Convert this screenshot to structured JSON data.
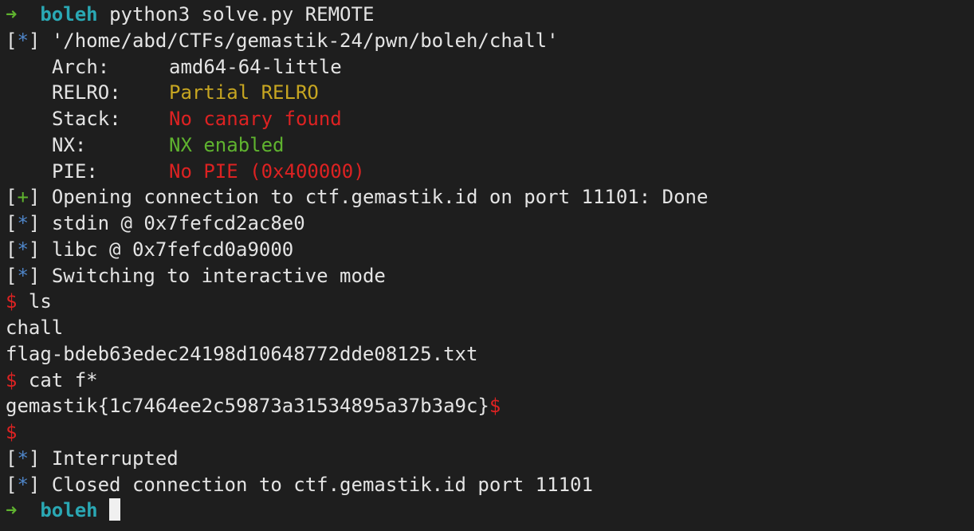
{
  "colors": {
    "background": "#1e1e1e",
    "text": "#e4e4e4",
    "prompt_arrow": "#5fb32f",
    "prompt_dir": "#2aa8b4",
    "info_marker": "#4f86c9",
    "success_marker": "#5fb32f",
    "shell_prompt": "#dd2222",
    "warning": "#c7a621",
    "ok": "#5fb32f"
  },
  "prompt": {
    "arrow": "➜",
    "dir": "boleh",
    "command": "python3 solve.py REMOTE"
  },
  "marker": {
    "open": "[",
    "close": "]",
    "info": "*",
    "success": "+"
  },
  "binary_path": "'/home/abd/CTFs/gemastik-24/pwn/boleh/chall'",
  "checksec": {
    "arch_key": "Arch:",
    "arch_value": "amd64-64-little",
    "relro_key": "RELRO:",
    "relro_value": "Partial RELRO",
    "stack_key": "Stack:",
    "stack_value": "No canary found",
    "nx_key": "NX:",
    "nx_value": "NX enabled",
    "pie_key": "PIE:",
    "pie_value": "No PIE (0x400000)"
  },
  "logs": {
    "opening": "Opening connection to ctf.gemastik.id on port 11101: Done",
    "stdin": "stdin @ 0x7fefcd2ac8e0",
    "libc": "libc @ 0x7fefcd0a9000",
    "switching": "Switching to interactive mode",
    "interrupted": "Interrupted",
    "closed": "Closed connection to ctf.gemastik.id port 11101"
  },
  "shell": {
    "prompt": "$",
    "cmd_ls": "ls",
    "ls_output_1": "chall",
    "ls_output_2": "flag-bdeb63edec24198d10648772dde08125.txt",
    "cmd_cat": "cat f*",
    "flag": "gemastik{1c7464ee2c59873a31534895a37b3a9c}"
  },
  "final_prompt": {
    "arrow": "➜",
    "dir": "boleh"
  }
}
